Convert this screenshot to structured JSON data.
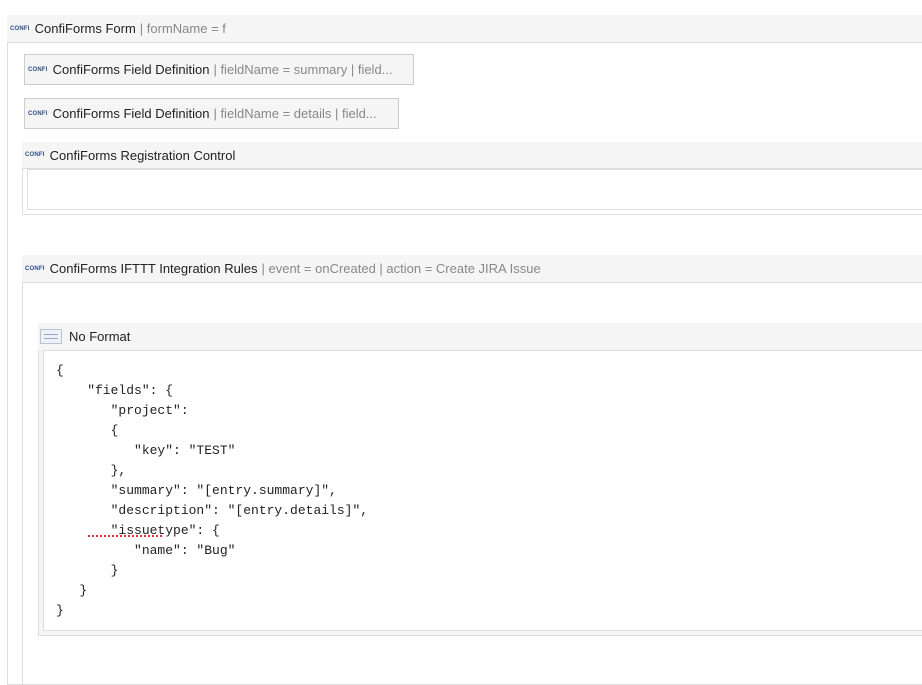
{
  "form_macro": {
    "icon": "CONFI",
    "title": "ConfiForms Form",
    "params": "| formName = f"
  },
  "field_def_1": {
    "icon": "CONFI",
    "title": "ConfiForms Field Definition",
    "params": "| fieldName = summary | field..."
  },
  "field_def_2": {
    "icon": "CONFI",
    "title": "ConfiForms Field Definition",
    "params": "| fieldName = details | field..."
  },
  "registration_control": {
    "icon": "CONFI",
    "title": "ConfiForms Registration Control"
  },
  "ifttt_rules": {
    "icon": "CONFI",
    "title": "ConfiForms IFTTT Integration Rules",
    "params": "| event = onCreated | action = Create JIRA Issue"
  },
  "no_format": {
    "title": "No Format",
    "code_lines": [
      "{",
      "    \"fields\": {",
      "       \"project\":",
      "       {",
      "          \"key\": \"TEST\"",
      "       },",
      "       \"summary\": \"[entry.summary]\",",
      "       \"description\": \"[entry.details]\",",
      "       \"issuetype\": {",
      "          \"name\": \"Bug\"",
      "       }",
      "   }",
      "}"
    ]
  }
}
